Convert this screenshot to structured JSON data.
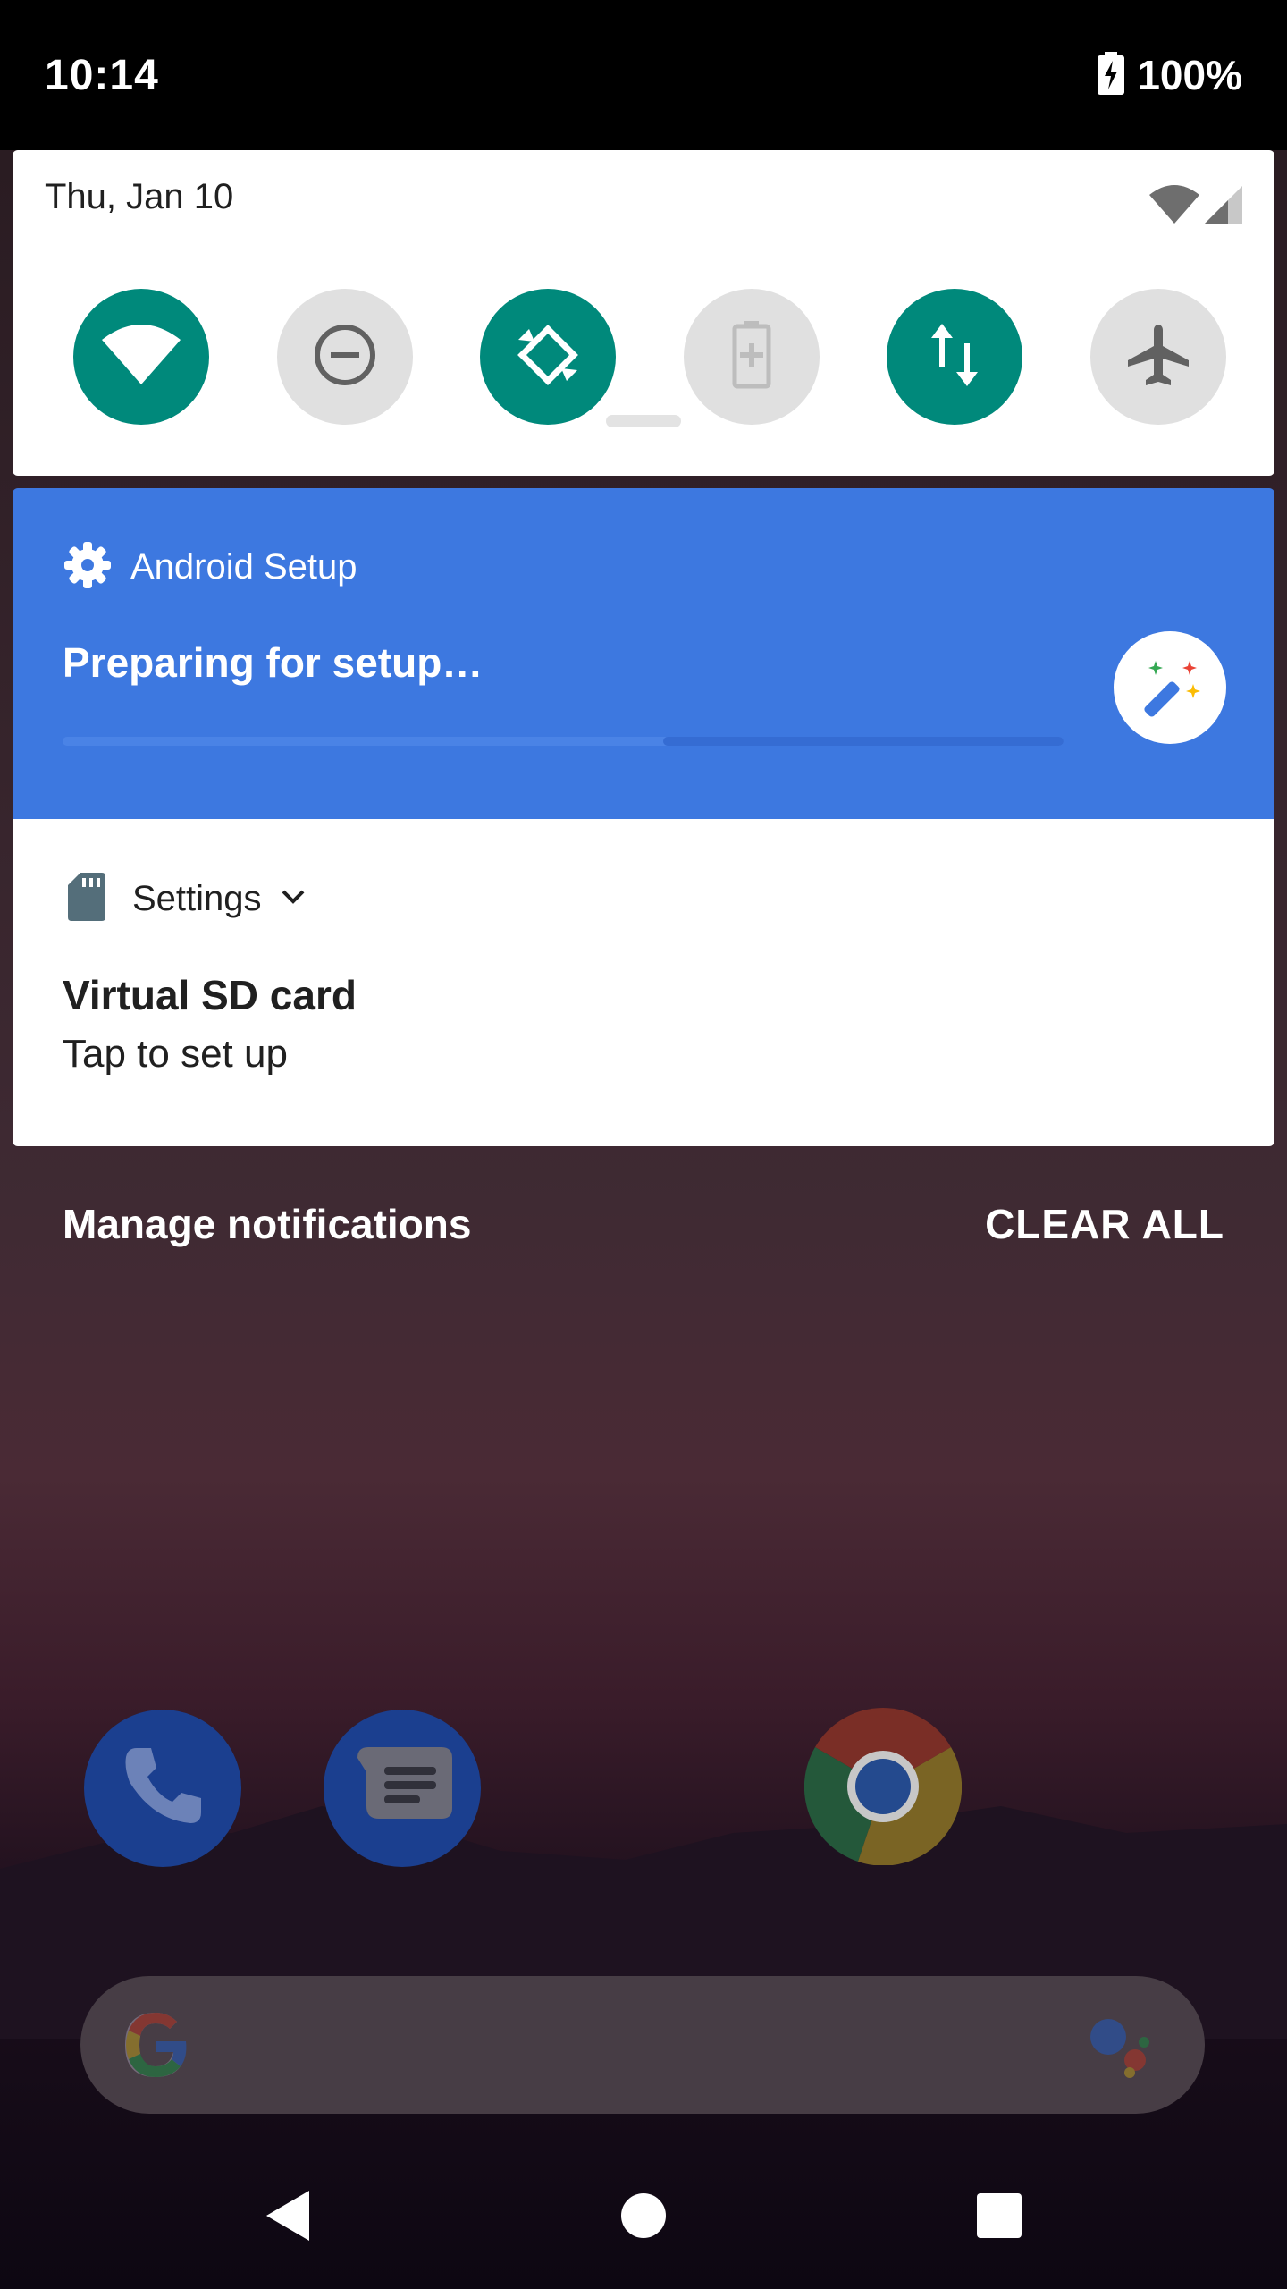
{
  "status_bar": {
    "time": "10:14",
    "battery_text": "100%"
  },
  "quick_settings": {
    "date": "Thu, Jan 10",
    "tiles": [
      {
        "name": "wifi",
        "state": "on"
      },
      {
        "name": "do-not-disturb",
        "state": "off"
      },
      {
        "name": "auto-rotate",
        "state": "on"
      },
      {
        "name": "battery-saver",
        "state": "off"
      },
      {
        "name": "mobile-data",
        "state": "on"
      },
      {
        "name": "airplane-mode",
        "state": "off"
      }
    ]
  },
  "notifications": {
    "setup": {
      "app_name": "Android Setup",
      "title": "Preparing for setup…",
      "progress": 0.6,
      "color": "#3d78e0"
    },
    "sd_card": {
      "app_name": "Settings",
      "title": "Virtual SD card",
      "text": "Tap to set up"
    },
    "manage_label": "Manage notifications",
    "clear_all_label": "CLEAR ALL"
  },
  "home": {
    "dock_apps": [
      "phone-icon",
      "messages-icon",
      "chrome-icon"
    ],
    "search": {
      "logo": "google-g-icon",
      "assistant": "assistant-icon"
    }
  },
  "nav": {
    "buttons": [
      "back",
      "home",
      "recents"
    ]
  }
}
